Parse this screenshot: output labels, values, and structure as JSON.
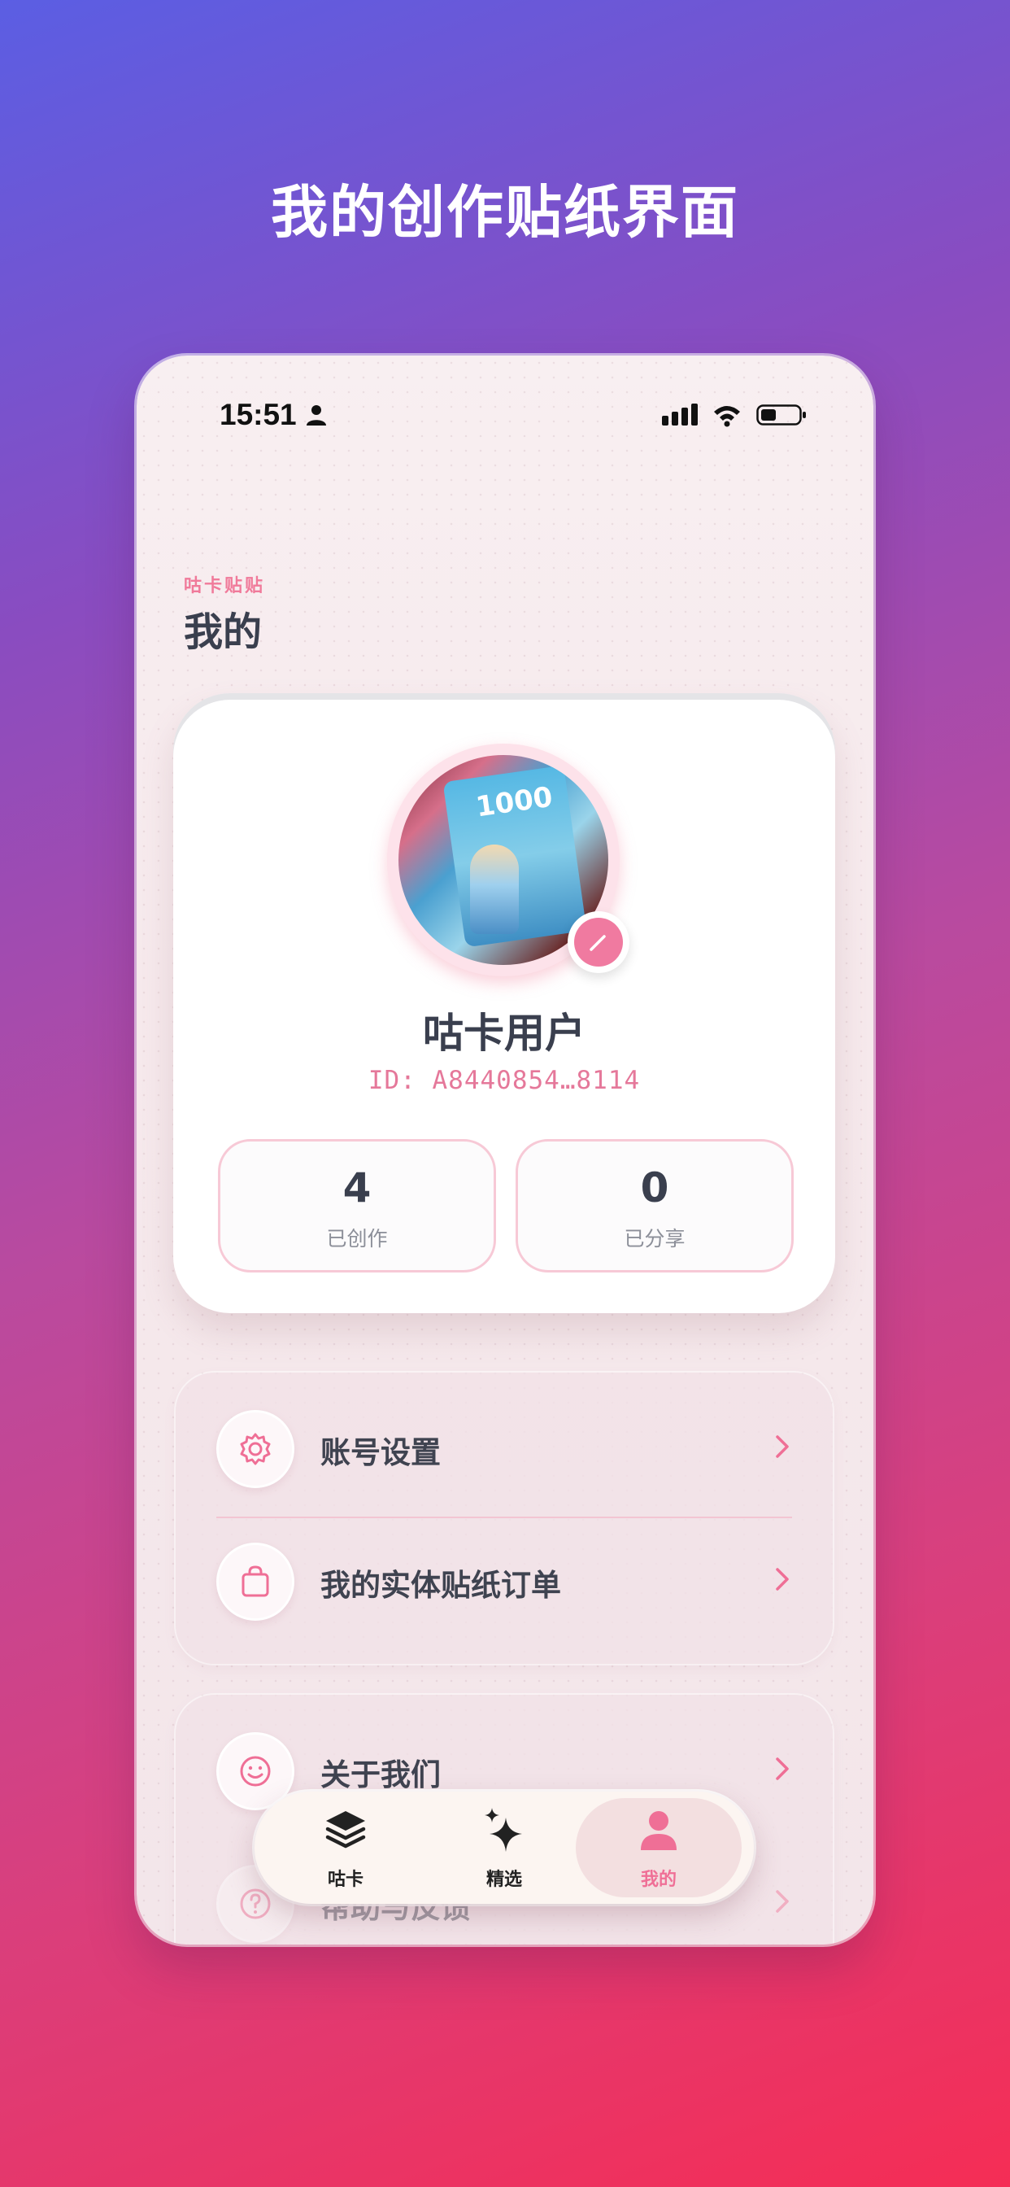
{
  "promo": {
    "title": "我的创作贴纸界面"
  },
  "status_bar": {
    "time": "15:51"
  },
  "header": {
    "brand": "咕卡贴贴",
    "title": "我的"
  },
  "profile": {
    "avatar_book_text": "1000",
    "name": "咕卡用户",
    "id": "ID: A8440854…8114",
    "stats": [
      {
        "value": "4",
        "label": "已创作"
      },
      {
        "value": "0",
        "label": "已分享"
      }
    ]
  },
  "menu": {
    "group1": [
      {
        "label": "账号设置",
        "icon": "gear-icon"
      },
      {
        "label": "我的实体贴纸订单",
        "icon": "bag-icon"
      }
    ],
    "group2": [
      {
        "label": "关于我们",
        "icon": "smile-icon"
      },
      {
        "label": "帮助与反馈",
        "icon": "help-icon"
      }
    ]
  },
  "tabs": [
    {
      "label": "咕卡",
      "icon": "stack-icon",
      "active": false
    },
    {
      "label": "精选",
      "icon": "sparkle-icon",
      "active": false
    },
    {
      "label": "我的",
      "icon": "person-icon",
      "active": true
    }
  ],
  "colors": {
    "accent": "#ef6f96",
    "text_dark": "#3a3f4e"
  }
}
